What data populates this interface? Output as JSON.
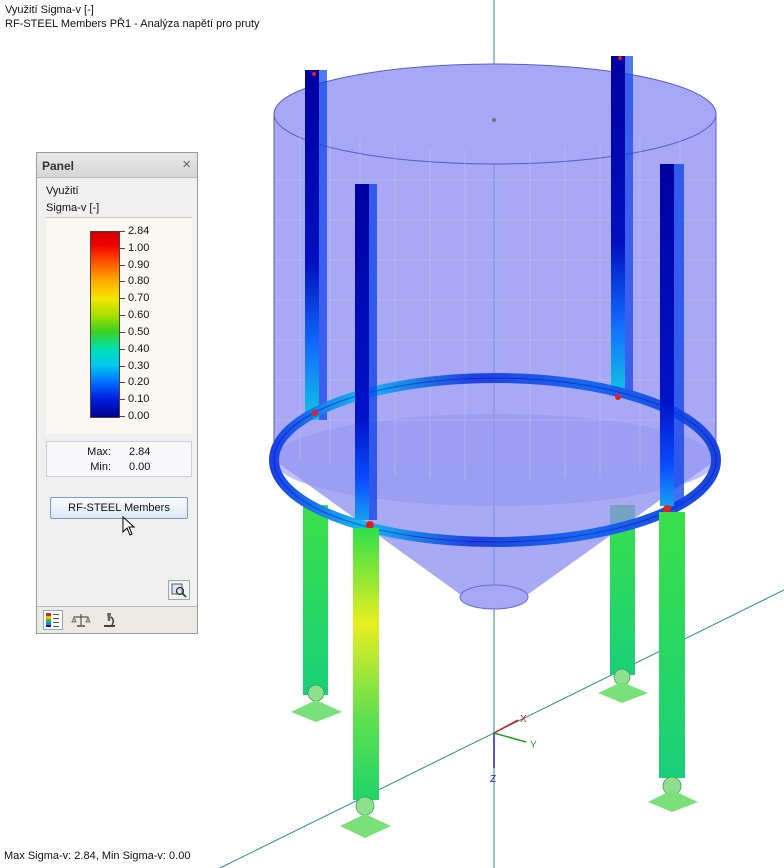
{
  "header": {
    "title_line1": "Využití Sigma-v [-]",
    "title_line2": "RF-STEEL Members PŘ1 - Analýza napětí pro pruty"
  },
  "panel": {
    "title": "Panel",
    "close_icon": "close-icon",
    "result_label": "Využití",
    "component_label": "Sigma-v [-]",
    "scale": {
      "values": [
        "2.84",
        "1.00",
        "0.90",
        "0.80",
        "0.70",
        "0.60",
        "0.50",
        "0.40",
        "0.30",
        "0.20",
        "0.10",
        "0.00"
      ],
      "colors": [
        "#d00000",
        "#f20000",
        "#ff5a00",
        "#ffb000",
        "#f5e600",
        "#a7e000",
        "#3ad020",
        "#00e0b0",
        "#00c8f0",
        "#0070ff",
        "#0020e0",
        "#000090"
      ]
    },
    "max_label": "Max:",
    "max_value": "2.84",
    "min_label": "Min:",
    "min_value": "0.00",
    "button_label": "RF-STEEL Members",
    "zoom_icon": "zoom-icon",
    "tabs": [
      "color-scale-icon",
      "balance-icon",
      "microscope-icon"
    ]
  },
  "axes": {
    "x": "X",
    "y": "Y",
    "z": "Z"
  },
  "status": "Max Sigma-v: 2.84, Min Sigma-v: 0.00"
}
